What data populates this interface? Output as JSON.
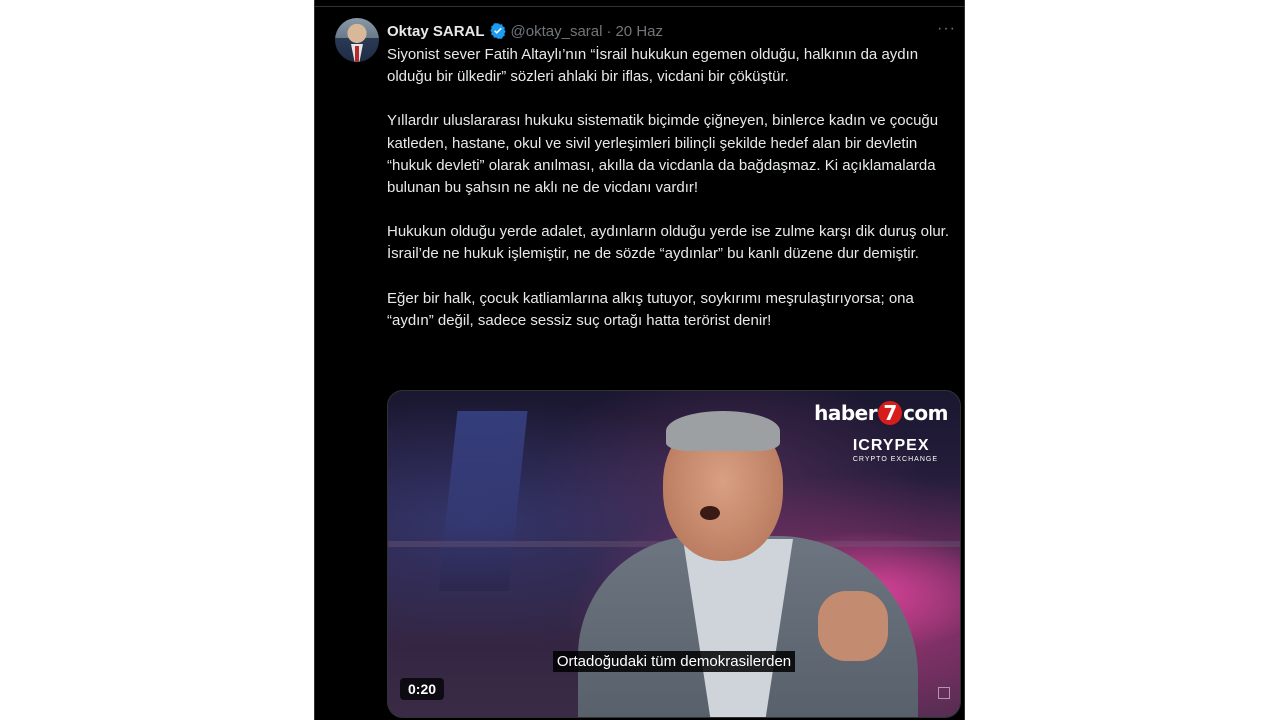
{
  "author": {
    "display_name": "Oktay SARAL",
    "handle": "@oktay_saral",
    "separator": "·",
    "date": "20 Haz",
    "verified": true
  },
  "more_label": "···",
  "tweet": {
    "paragraphs": [
      "Siyonist sever Fatih Altaylı’nın “İsrail hukukun egemen olduğu, halkının da aydın olduğu bir ülkedir” sözleri ahlaki bir iflas, vicdani bir çöküştür.",
      "Yıllardır uluslararası hukuku sistematik biçimde çiğneyen, binlerce kadın ve çocuğu katleden, hastane, okul ve sivil yerleşimleri bilinçli şekilde hedef alan bir devletin “hukuk devleti” olarak anılması, akılla da vicdanla da bağdaşmaz. Ki açıklamalarda bulunan bu şahsın ne aklı ne de vicdanı vardır!",
      "Hukukun olduğu yerde adalet, aydınların olduğu yerde ise zulme karşı dik duruş olur. İsrail’de ne hukuk işlemiştir, ne de sözde “aydınlar” bu kanlı düzene dur demiştir.",
      "Eğer bir halk, çocuk katliamlarına alkış tutuyor, soykırımı meşrulaştırıyorsa; ona “aydın” değil, sadece sessiz suç ortağı hatta terörist denir!"
    ]
  },
  "video": {
    "subtitle": "Ortadoğudaki tüm demokrasilerden",
    "duration": "0:20",
    "logo_left": "haber",
    "logo_seven": "7",
    "logo_right": "com",
    "sponsor": "ICRYPEX",
    "sponsor_sub": "CRYPTO EXCHANGE"
  },
  "colors": {
    "background": "#000000",
    "text": "#e7e9ea",
    "muted": "#71767b",
    "verified": "#1d9bf0"
  }
}
